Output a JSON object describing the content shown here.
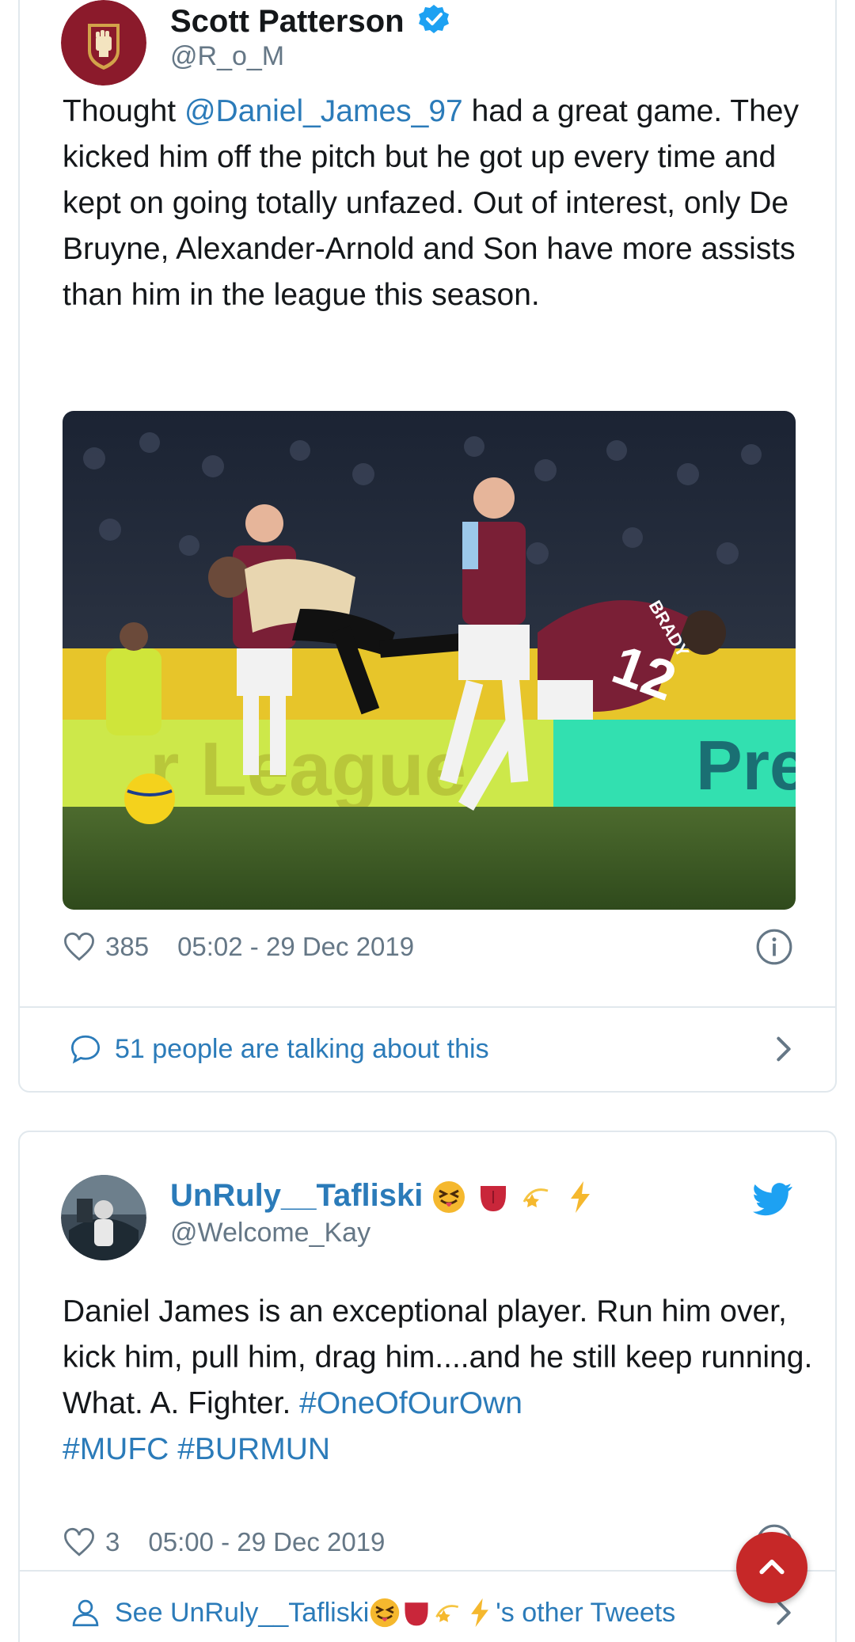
{
  "tweet1": {
    "author_name": "Scott Patterson",
    "author_handle": "@R_o_M",
    "verified": true,
    "text_mention": "@Daniel_James_97",
    "text_before": "Thought ",
    "text_after": " had a great game. They kicked him off the pitch but he got up every time and kept on going totally unfazed. Out of interest, only De Bruyne, Alexander-Arnold and Son have more assists than him in the league this season.",
    "photo_shirt_text": "BRADY",
    "photo_shirt_number": "12",
    "likes": "385",
    "timestamp": "05:02 - 29 Dec 2019",
    "conversation_label": "51 people are talking about this",
    "icons": {
      "like": "heart-icon",
      "info": "info-icon",
      "reply": "speech-bubble-icon",
      "more": "chevron-right-icon"
    }
  },
  "tweet2": {
    "author_name": "UnRuly__Tafliski",
    "author_handle": "@Welcome_Kay",
    "text_plain": "Daniel James is an exceptional player. Run him over, kick him, pull him, drag him....and he still keep running. What. A. Fighter. ",
    "hashtags": [
      "#OneOfOurOwn",
      "#MUFC",
      "#BURMUN"
    ],
    "likes": "3",
    "timestamp": "05:00 - 29 Dec 2019",
    "see_more_prefix": "See ",
    "see_more_name": "UnRuly__Tafliski",
    "see_more_suffix": "'s other Tweets",
    "icons": {
      "source": "twitter-bird-icon",
      "like": "heart-icon",
      "info": "info-icon",
      "profile": "person-icon",
      "more": "chevron-right-icon"
    }
  },
  "colors": {
    "link": "#2b7bb9",
    "muted": "#657786",
    "border": "#e1e8ed",
    "verified": "#1da1f2",
    "scroll_button": "#c62828"
  },
  "scroll_top_icon": "chevron-up-icon"
}
